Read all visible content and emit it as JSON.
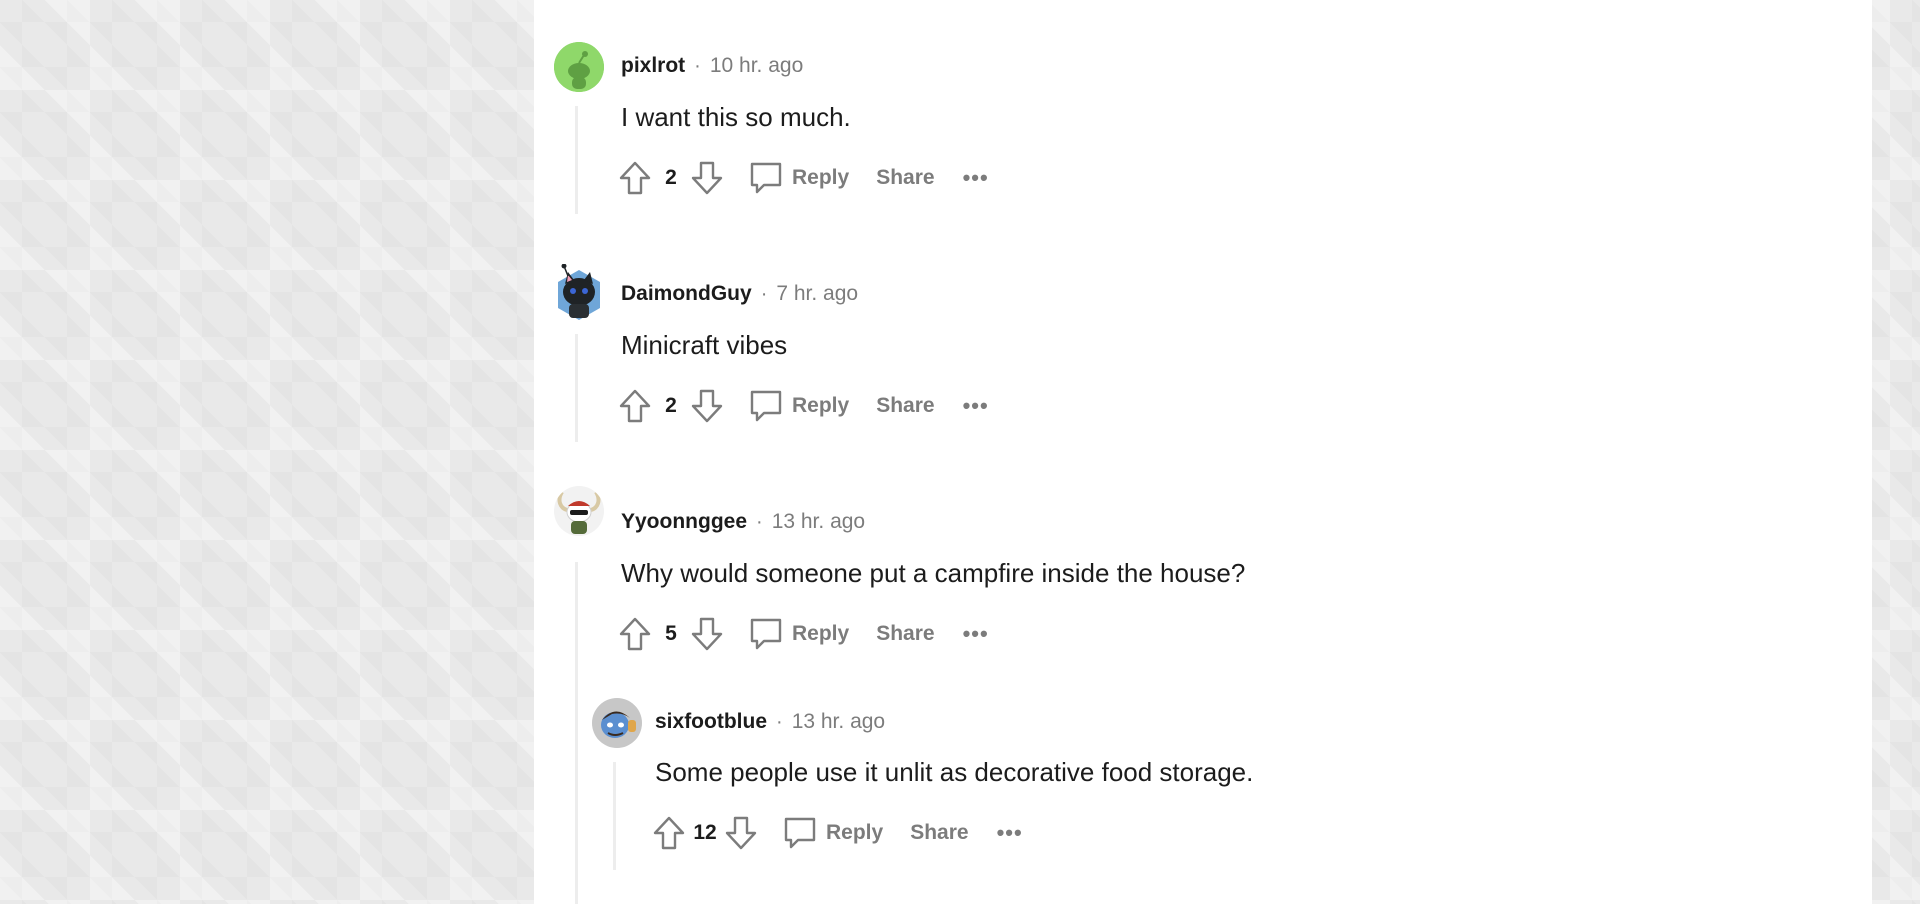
{
  "comments": [
    {
      "author": "pixlrot",
      "separator": "·",
      "time": "10 hr. ago",
      "text": "I want this so much.",
      "score": "2",
      "reply_label": "Reply",
      "share_label": "Share",
      "more_label": "•••",
      "avatar": "green-snoo-avatar"
    },
    {
      "author": "DaimondGuy",
      "separator": "·",
      "time": "7 hr. ago",
      "text": "Minicraft vibes",
      "score": "2",
      "reply_label": "Reply",
      "share_label": "Share",
      "more_label": "•••",
      "avatar": "black-cat-snoo-avatar"
    },
    {
      "author": "Yyoonnggee",
      "separator": "·",
      "time": "13 hr. ago",
      "text": "Why would someone put a campfire inside the house?",
      "score": "5",
      "reply_label": "Reply",
      "share_label": "Share",
      "more_label": "•••",
      "avatar": "horned-snoo-avatar",
      "replies": [
        {
          "author": "sixfootblue",
          "separator": "·",
          "time": "13 hr. ago",
          "text": "Some people use it unlit as decorative food storage.",
          "score": "12",
          "reply_label": "Reply",
          "share_label": "Share",
          "more_label": "•••",
          "avatar": "blue-face-snoo-avatar"
        }
      ]
    }
  ],
  "colors": {
    "background": "#e9e9e9",
    "panel": "#ffffff",
    "text": "#1c1c1c",
    "muted": "#7c7c7c",
    "thread_line": "#ededed"
  }
}
